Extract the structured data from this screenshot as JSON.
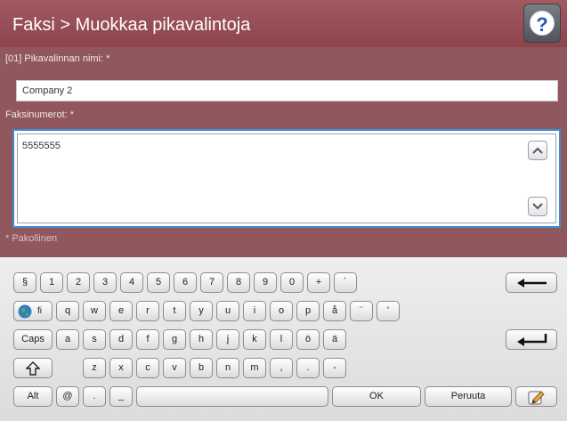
{
  "header": {
    "title": "Faksi > Muokkaa pikavalintoja",
    "help_icon": "question-mark-icon",
    "help_glyph": "?"
  },
  "form": {
    "name_label": "[01] Pikavalinnan nimi: *",
    "name_value": "Company 2",
    "fax_label": "Faksinumerot: *",
    "fax_value": "5555555",
    "required_note": "* Pakollinen",
    "scroll_up_icon": "chevron-up-icon",
    "scroll_down_icon": "chevron-down-icon"
  },
  "keyboard": {
    "row1": [
      "§",
      "1",
      "2",
      "3",
      "4",
      "5",
      "6",
      "7",
      "8",
      "9",
      "0",
      "+",
      "´"
    ],
    "backspace_icon": "backspace-arrow-icon",
    "globe_icon": "globe-icon",
    "language": "fi",
    "row2": [
      "q",
      "w",
      "e",
      "r",
      "t",
      "y",
      "u",
      "i",
      "o",
      "p",
      "å",
      "¨",
      "'"
    ],
    "caps_label": "Caps",
    "row3": [
      "a",
      "s",
      "d",
      "f",
      "g",
      "h",
      "j",
      "k",
      "l",
      "ö",
      "ä"
    ],
    "enter_icon": "enter-return-icon",
    "shift_icon": "shift-arrow-icon",
    "row4": [
      "z",
      "x",
      "c",
      "v",
      "b",
      "n",
      "m",
      ",",
      ".",
      "-"
    ],
    "alt_label": "Alt",
    "at_label": "@",
    "dot_label": ".",
    "underscore_label": "_",
    "ok_label": "OK",
    "cancel_label": "Peruuta",
    "edit_icon": "pencil-icon"
  }
}
